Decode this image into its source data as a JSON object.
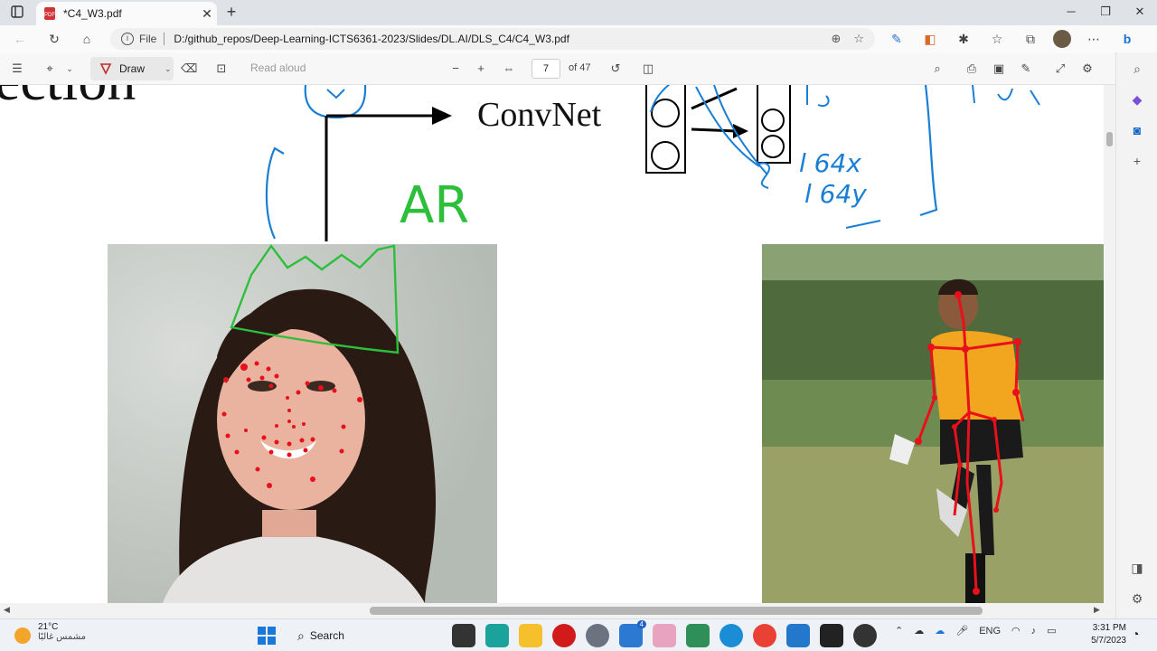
{
  "browser": {
    "tab_title": "*C4_W3.pdf",
    "address_prefix": "File",
    "url": "D:/github_repos/Deep-Learning-ICTS6361-2023/Slides/DL.AI/DLS_C4/C4_W3.pdf"
  },
  "pdf_toolbar": {
    "draw_label": "Draw",
    "read_aloud_label": "Read aloud",
    "current_page": "7",
    "page_count": "of 47"
  },
  "slide": {
    "title_fragment": "ection",
    "convnet_label": "ConvNet",
    "annotation_ar": "AR",
    "handwritten_lines": [
      "l 64x",
      "l 64y"
    ]
  },
  "taskbar": {
    "temperature": "21°C",
    "weather_text": "مشمس غالبًا",
    "search_label": "Search",
    "language": "ENG",
    "time": "3:31 PM",
    "date": "5/7/2023",
    "badge_count": "4"
  },
  "colors": {
    "annotation_blue": "#1a7fd4",
    "annotation_green": "#2dbf3c",
    "landmark_red": "#e8101a"
  }
}
